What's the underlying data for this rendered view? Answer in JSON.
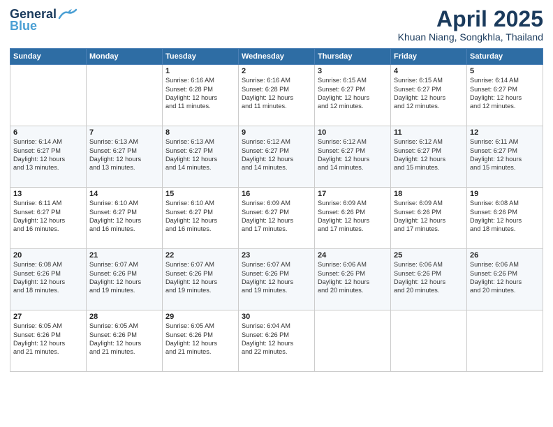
{
  "header": {
    "logo": {
      "line1": "General",
      "line2": "Blue"
    },
    "title": "April 2025",
    "location": "Khuan Niang, Songkhla, Thailand"
  },
  "calendar": {
    "days_of_week": [
      "Sunday",
      "Monday",
      "Tuesday",
      "Wednesday",
      "Thursday",
      "Friday",
      "Saturday"
    ],
    "weeks": [
      [
        {
          "day": "",
          "info": ""
        },
        {
          "day": "",
          "info": ""
        },
        {
          "day": "1",
          "info": "Sunrise: 6:16 AM\nSunset: 6:28 PM\nDaylight: 12 hours\nand 11 minutes."
        },
        {
          "day": "2",
          "info": "Sunrise: 6:16 AM\nSunset: 6:28 PM\nDaylight: 12 hours\nand 11 minutes."
        },
        {
          "day": "3",
          "info": "Sunrise: 6:15 AM\nSunset: 6:27 PM\nDaylight: 12 hours\nand 12 minutes."
        },
        {
          "day": "4",
          "info": "Sunrise: 6:15 AM\nSunset: 6:27 PM\nDaylight: 12 hours\nand 12 minutes."
        },
        {
          "day": "5",
          "info": "Sunrise: 6:14 AM\nSunset: 6:27 PM\nDaylight: 12 hours\nand 12 minutes."
        }
      ],
      [
        {
          "day": "6",
          "info": "Sunrise: 6:14 AM\nSunset: 6:27 PM\nDaylight: 12 hours\nand 13 minutes."
        },
        {
          "day": "7",
          "info": "Sunrise: 6:13 AM\nSunset: 6:27 PM\nDaylight: 12 hours\nand 13 minutes."
        },
        {
          "day": "8",
          "info": "Sunrise: 6:13 AM\nSunset: 6:27 PM\nDaylight: 12 hours\nand 14 minutes."
        },
        {
          "day": "9",
          "info": "Sunrise: 6:12 AM\nSunset: 6:27 PM\nDaylight: 12 hours\nand 14 minutes."
        },
        {
          "day": "10",
          "info": "Sunrise: 6:12 AM\nSunset: 6:27 PM\nDaylight: 12 hours\nand 14 minutes."
        },
        {
          "day": "11",
          "info": "Sunrise: 6:12 AM\nSunset: 6:27 PM\nDaylight: 12 hours\nand 15 minutes."
        },
        {
          "day": "12",
          "info": "Sunrise: 6:11 AM\nSunset: 6:27 PM\nDaylight: 12 hours\nand 15 minutes."
        }
      ],
      [
        {
          "day": "13",
          "info": "Sunrise: 6:11 AM\nSunset: 6:27 PM\nDaylight: 12 hours\nand 16 minutes."
        },
        {
          "day": "14",
          "info": "Sunrise: 6:10 AM\nSunset: 6:27 PM\nDaylight: 12 hours\nand 16 minutes."
        },
        {
          "day": "15",
          "info": "Sunrise: 6:10 AM\nSunset: 6:27 PM\nDaylight: 12 hours\nand 16 minutes."
        },
        {
          "day": "16",
          "info": "Sunrise: 6:09 AM\nSunset: 6:27 PM\nDaylight: 12 hours\nand 17 minutes."
        },
        {
          "day": "17",
          "info": "Sunrise: 6:09 AM\nSunset: 6:26 PM\nDaylight: 12 hours\nand 17 minutes."
        },
        {
          "day": "18",
          "info": "Sunrise: 6:09 AM\nSunset: 6:26 PM\nDaylight: 12 hours\nand 17 minutes."
        },
        {
          "day": "19",
          "info": "Sunrise: 6:08 AM\nSunset: 6:26 PM\nDaylight: 12 hours\nand 18 minutes."
        }
      ],
      [
        {
          "day": "20",
          "info": "Sunrise: 6:08 AM\nSunset: 6:26 PM\nDaylight: 12 hours\nand 18 minutes."
        },
        {
          "day": "21",
          "info": "Sunrise: 6:07 AM\nSunset: 6:26 PM\nDaylight: 12 hours\nand 19 minutes."
        },
        {
          "day": "22",
          "info": "Sunrise: 6:07 AM\nSunset: 6:26 PM\nDaylight: 12 hours\nand 19 minutes."
        },
        {
          "day": "23",
          "info": "Sunrise: 6:07 AM\nSunset: 6:26 PM\nDaylight: 12 hours\nand 19 minutes."
        },
        {
          "day": "24",
          "info": "Sunrise: 6:06 AM\nSunset: 6:26 PM\nDaylight: 12 hours\nand 20 minutes."
        },
        {
          "day": "25",
          "info": "Sunrise: 6:06 AM\nSunset: 6:26 PM\nDaylight: 12 hours\nand 20 minutes."
        },
        {
          "day": "26",
          "info": "Sunrise: 6:06 AM\nSunset: 6:26 PM\nDaylight: 12 hours\nand 20 minutes."
        }
      ],
      [
        {
          "day": "27",
          "info": "Sunrise: 6:05 AM\nSunset: 6:26 PM\nDaylight: 12 hours\nand 21 minutes."
        },
        {
          "day": "28",
          "info": "Sunrise: 6:05 AM\nSunset: 6:26 PM\nDaylight: 12 hours\nand 21 minutes."
        },
        {
          "day": "29",
          "info": "Sunrise: 6:05 AM\nSunset: 6:26 PM\nDaylight: 12 hours\nand 21 minutes."
        },
        {
          "day": "30",
          "info": "Sunrise: 6:04 AM\nSunset: 6:26 PM\nDaylight: 12 hours\nand 22 minutes."
        },
        {
          "day": "",
          "info": ""
        },
        {
          "day": "",
          "info": ""
        },
        {
          "day": "",
          "info": ""
        }
      ]
    ]
  }
}
